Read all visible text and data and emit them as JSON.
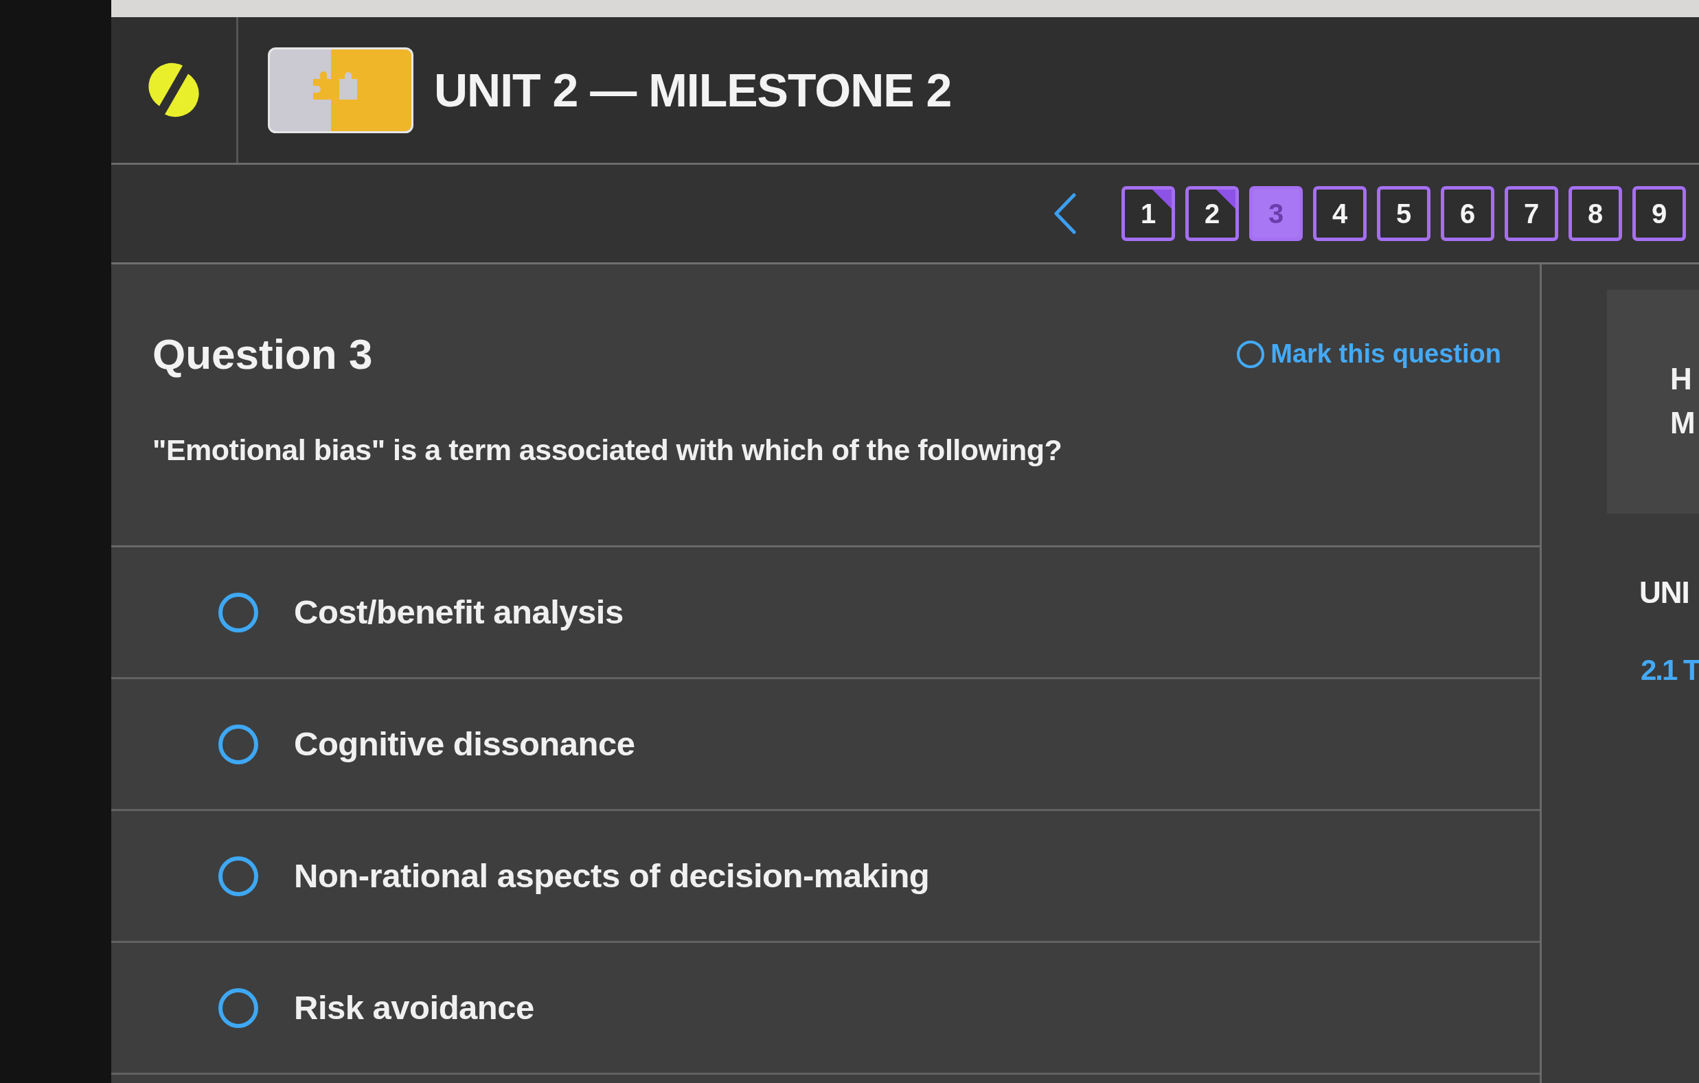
{
  "header": {
    "title": "UNIT 2 — MILESTONE 2"
  },
  "pager": {
    "pages": [
      {
        "label": "1",
        "answered": true,
        "selected": false
      },
      {
        "label": "2",
        "answered": true,
        "selected": false
      },
      {
        "label": "3",
        "answered": false,
        "selected": true
      },
      {
        "label": "4",
        "answered": false,
        "selected": false
      },
      {
        "label": "5",
        "answered": false,
        "selected": false
      },
      {
        "label": "6",
        "answered": false,
        "selected": false
      },
      {
        "label": "7",
        "answered": false,
        "selected": false
      },
      {
        "label": "8",
        "answered": false,
        "selected": false
      },
      {
        "label": "9",
        "answered": false,
        "selected": false
      }
    ]
  },
  "question": {
    "title": "Question 3",
    "mark_link": {
      "label": "Mark this question",
      "checked": false
    },
    "prompt": "\"Emotional bias\" is a term associated with which of the following?",
    "options": [
      {
        "label": "Cost/benefit analysis",
        "selected": false
      },
      {
        "label": "Cognitive dissonance",
        "selected": false
      },
      {
        "label": "Non-rational aspects of decision-making",
        "selected": false
      },
      {
        "label": "Risk avoidance",
        "selected": false
      }
    ]
  },
  "sidebar": {
    "card_lines": [
      "H",
      "M"
    ],
    "heading": "UNI",
    "link": "2.1 T"
  }
}
